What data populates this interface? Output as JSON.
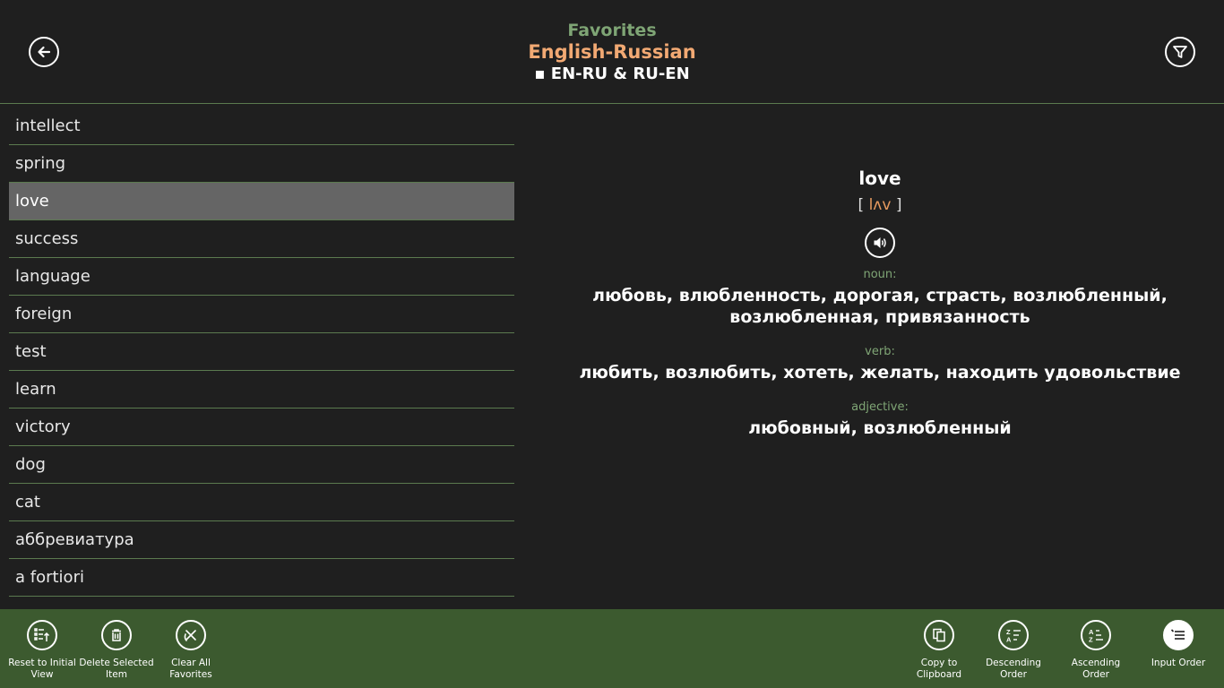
{
  "header": {
    "section": "Favorites",
    "dictionary": "English-Russian",
    "direction": "▪ EN-RU & RU-EN",
    "back_icon": "back-arrow-icon",
    "filter_icon": "filter-icon"
  },
  "word_list": {
    "items": [
      "intellect",
      "spring",
      "love",
      "success",
      "language",
      "foreign",
      "test",
      "learn",
      "victory",
      "dog",
      "cat",
      "аббревиатура",
      "a fortiori"
    ],
    "selected_index": 2
  },
  "detail": {
    "headword": "love",
    "transcription_open": "[ ",
    "transcription": "lʌv",
    "transcription_close": " ]",
    "sound_icon": "speaker-icon",
    "senses": [
      {
        "pos": "noun:",
        "translations_line1": "любовь, влюбленность, дорогая, страсть, возлюбленный,",
        "translations_line2": "возлюбленная, привязанность"
      },
      {
        "pos": "verb:",
        "translations_line1": "любить, возлюбить, хотеть, желать, находить удовольствие"
      },
      {
        "pos": "adjective:",
        "translations_line1": "любовный, возлюбленный"
      }
    ]
  },
  "appbar": {
    "left": [
      {
        "label_1": "Reset to Initial",
        "label_2": "View",
        "icon": "reset-view-icon"
      },
      {
        "label_1": "Delete Selected",
        "label_2": "Item",
        "icon": "trash-icon"
      },
      {
        "label_1": "Clear All",
        "label_2": "Favorites",
        "icon": "clear-all-icon"
      }
    ],
    "right": [
      {
        "label_1": "Copy to",
        "label_2": "Clipboard",
        "icon": "copy-icon"
      },
      {
        "label_1": "Descending",
        "label_2": "Order",
        "icon": "sort-descending-icon"
      },
      {
        "label_1": "Ascending",
        "label_2": "Order",
        "icon": "sort-ascending-icon"
      },
      {
        "label_1": "Input Order",
        "label_2": "",
        "icon": "input-order-icon"
      }
    ]
  },
  "colors": {
    "accent_green": "#7fa575",
    "accent_orange": "#f2a973",
    "appbar_bg": "#3c5a2f",
    "selected_bg": "#656565"
  }
}
